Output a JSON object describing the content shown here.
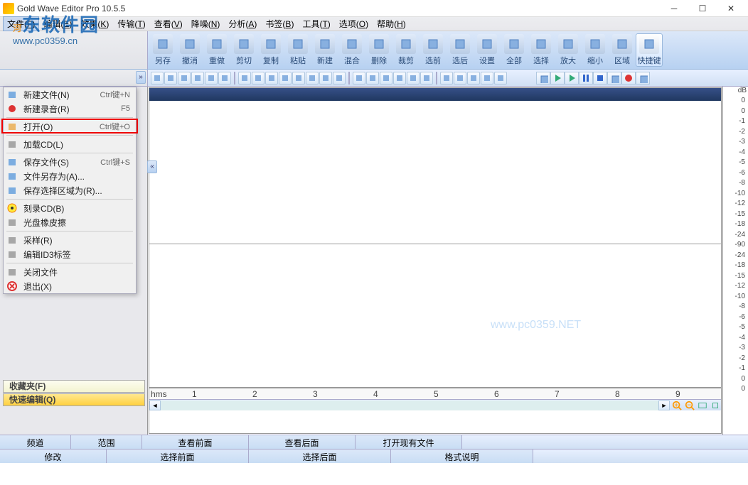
{
  "title": "Gold Wave Editor Pro 10.5.5",
  "watermark": {
    "text1": "河东软件园",
    "text2": "www.pc0359.cn",
    "center": "www.pc0359.NET"
  },
  "menubar": [
    {
      "t": "文件",
      "k": "F"
    },
    {
      "t": "编辑",
      "k": "E"
    },
    {
      "t": "效果",
      "k": "K"
    },
    {
      "t": "传输",
      "k": "T"
    },
    {
      "t": "查看",
      "k": "V"
    },
    {
      "t": "降噪",
      "k": "N"
    },
    {
      "t": "分析",
      "k": "A"
    },
    {
      "t": "书签",
      "k": "B"
    },
    {
      "t": "工具",
      "k": "T"
    },
    {
      "t": "选项",
      "k": "O"
    },
    {
      "t": "帮助",
      "k": "H"
    }
  ],
  "file_menu": [
    {
      "icon": "new",
      "t": "新建文件(N)",
      "s": "Ctrl键+N"
    },
    {
      "icon": "rec",
      "t": "新建录音(R)",
      "s": "F5"
    },
    {
      "sep": true
    },
    {
      "icon": "open",
      "t": "打开(O)",
      "s": "Ctrl键+O",
      "hl": true
    },
    {
      "sep": true
    },
    {
      "icon": "cd",
      "t": "加载CD(L)"
    },
    {
      "sep": true
    },
    {
      "icon": "save",
      "t": "保存文件(S)",
      "s": "Ctrl键+S"
    },
    {
      "icon": "saveas",
      "t": "文件另存为(A)..."
    },
    {
      "icon": "savesel",
      "t": "保存选择区域为(R)..."
    },
    {
      "sep": true
    },
    {
      "icon": "burn",
      "t": "刻录CD(B)"
    },
    {
      "icon": "erase",
      "t": "光盘橡皮擦"
    },
    {
      "sep": true
    },
    {
      "icon": "sample",
      "t": "采样(R)"
    },
    {
      "icon": "id3",
      "t": "编辑ID3标签"
    },
    {
      "sep": true
    },
    {
      "icon": "close",
      "t": "关闭文件"
    },
    {
      "icon": "exit",
      "t": "退出(X)"
    }
  ],
  "toolbar": [
    "另存",
    "撤消",
    "重做",
    "剪切",
    "复制",
    "粘贴",
    "新建",
    "混合",
    "删除",
    "裁剪",
    "选前",
    "选后",
    "设置",
    "全部",
    "选择",
    "放大",
    "缩小",
    "区域",
    "快捷键"
  ],
  "panels": {
    "fav": "收藏夹(F)",
    "quick": "快速编辑(Q)"
  },
  "status1": [
    "频道",
    "范围",
    "查看前面",
    "查看后面",
    "打开现有文件"
  ],
  "status2": [
    "修改",
    "选择前面",
    "选择后面",
    "格式说明"
  ],
  "ruler": {
    "unit": "hms",
    "ticks": [
      "1",
      "2",
      "3",
      "4",
      "5",
      "6",
      "7",
      "8",
      "9"
    ]
  },
  "db": {
    "label": "dB",
    "vals": [
      "0",
      "0",
      "-1",
      "-2",
      "-3",
      "-4",
      "-5",
      "-6",
      "-8",
      "-10",
      "-12",
      "-15",
      "-18",
      "-24",
      "-90",
      "-24",
      "-18",
      "-15",
      "-12",
      "-10",
      "-8",
      "-6",
      "-5",
      "-4",
      "-3",
      "-2",
      "-1",
      "0",
      "0"
    ]
  }
}
